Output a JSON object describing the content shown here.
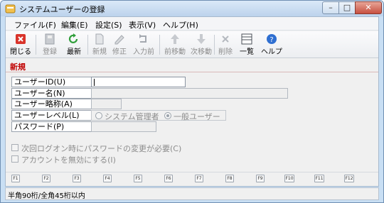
{
  "window": {
    "title": "システムユーザーの登録"
  },
  "menu": [
    "ファイル(F)",
    "編集(E)",
    "設定(S)",
    "表示(V)",
    "ヘルプ(H)"
  ],
  "toolbar": {
    "close": "閉じる",
    "register": "登録",
    "refresh": "最新",
    "new": "新規",
    "edit": "修正",
    "prev_input": "入力前",
    "move_prev": "前移動",
    "move_next": "次移動",
    "delete": "削除",
    "list": "一覧",
    "help": "ヘルプ"
  },
  "mode": "新規",
  "form": {
    "user_id_label": "ユーザーID(U)",
    "user_name_label": "ユーザー名(N)",
    "user_abbr_label": "ユーザー略称(A)",
    "user_level_label": "ユーザーレベル(L)",
    "password_label": "パスワード(P)",
    "user_id_value": "",
    "level_option_admin": "システム管理者",
    "level_option_general": "一般ユーザー",
    "selected_level": "一般ユーザー"
  },
  "options": {
    "require_password_change": "次回ログオン時にパスワードの変更が必要(C)",
    "disable_account": "アカウントを無効にする(I)"
  },
  "function_keys": [
    "F1",
    "F2",
    "F3",
    "F4",
    "F5",
    "F6",
    "F7",
    "F8",
    "F9",
    "F10",
    "F11",
    "F12"
  ],
  "status": "半角90桁/全角45桁以内"
}
